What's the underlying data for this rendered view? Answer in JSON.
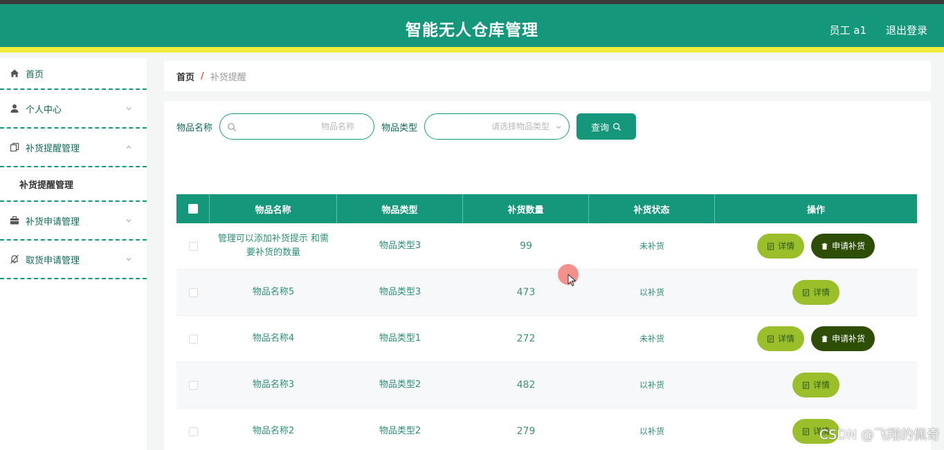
{
  "header": {
    "title": "智能无人仓库管理",
    "user": "员工 a1",
    "logout": "退出登录"
  },
  "sidebar": {
    "items": [
      {
        "label": "首页",
        "icon": "home-icon"
      },
      {
        "label": "个人中心",
        "icon": "user-icon"
      },
      {
        "label": "补货提醒管理",
        "icon": "copy-icon"
      },
      {
        "label": "补货申请管理",
        "icon": "briefcase-icon"
      },
      {
        "label": "取货申请管理",
        "icon": "bell-off-icon"
      }
    ],
    "submenu": {
      "label": "补货提醒管理"
    }
  },
  "breadcrumb": {
    "home": "首页",
    "sep": "/",
    "current": "补货提醒"
  },
  "search": {
    "name_label": "物品名称",
    "name_placeholder": "物品名称",
    "type_label": "物品类型",
    "type_placeholder": "请选择物品类型",
    "query_label": "查询"
  },
  "table": {
    "headers": [
      "物品名称",
      "物品类型",
      "补货数量",
      "补货状态",
      "操作"
    ],
    "rows": [
      {
        "name": "管理可以添加补货提示 和需要补货的数量",
        "type": "物品类型3",
        "qty": "99",
        "status": "未补货"
      },
      {
        "name": "物品名称5",
        "type": "物品类型3",
        "qty": "473",
        "status": "以补货"
      },
      {
        "name": "物品名称4",
        "type": "物品类型1",
        "qty": "272",
        "status": "未补货"
      },
      {
        "name": "物品名称3",
        "type": "物品类型2",
        "qty": "482",
        "status": "以补货"
      },
      {
        "name": "物品名称2",
        "type": "物品类型2",
        "qty": "279",
        "status": "以补货"
      }
    ],
    "detail_label": "详情",
    "apply_label": "申请补货"
  },
  "watermark": "CSDN @飞翔的佩奇",
  "colors": {
    "primary": "#14977a",
    "accent_strip": "#f2ec3e",
    "detail_btn": "#9bbf2a",
    "apply_btn": "#2e4e07"
  }
}
